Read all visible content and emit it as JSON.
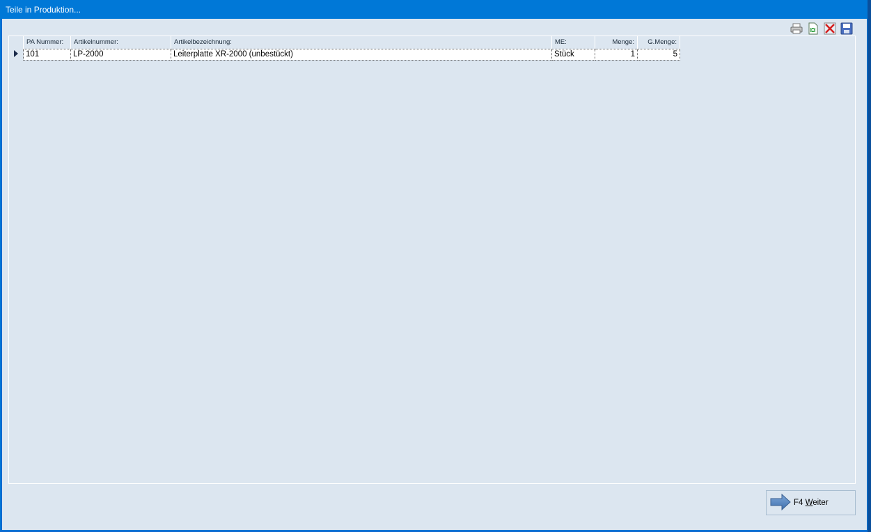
{
  "window": {
    "title": "Teile in Produktion..."
  },
  "toolbar": {
    "icons": [
      "printer-icon",
      "export-excel-icon",
      "delete-icon",
      "save-icon"
    ]
  },
  "table": {
    "columns": [
      "PA Nummer:",
      "Artikelnummer:",
      "Artikelbezeichnung:",
      "ME:",
      "Menge:",
      "G.Menge:"
    ],
    "rows": [
      [
        "101",
        "LP-2000",
        "Leiterplatte XR-2000 (unbestückt)",
        "Stück",
        "1",
        "5"
      ]
    ]
  },
  "footer": {
    "next_button_prefix": "F4 ",
    "next_button_mnemonic": "W",
    "next_button_rest": "eiter"
  },
  "colors": {
    "titlebar": "#0078d7",
    "background": "#dce6f0"
  }
}
